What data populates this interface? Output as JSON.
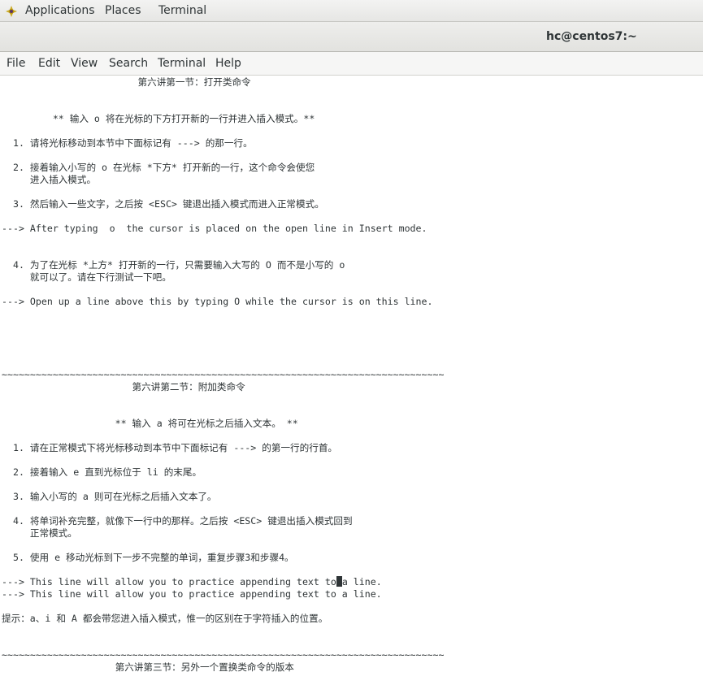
{
  "topbar": {
    "applications": "Applications",
    "places": "Places",
    "terminal": "Terminal"
  },
  "window": {
    "title": "hc@centos7:~"
  },
  "menubar": {
    "file": "File",
    "edit": "Edit",
    "view": "View",
    "search": "Search",
    "terminal": "Terminal",
    "help": "Help"
  },
  "terminal": {
    "lines": {
      "l0": "                        第六讲第一节：打开类命令",
      "l3": "         ** 输入 o 将在光标的下方打开新的一行并进入插入模式。**",
      "l5": "  1. 请将光标移动到本节中下面标记有 ---> 的那一行。",
      "l7": "  2. 接着输入小写的 o 在光标 *下方* 打开新的一行，这个命令会使您",
      "l8": "     进入插入模式。",
      "l10": "  3. 然后输入一些文字，之后按 <ESC> 键退出插入模式而进入正常模式。",
      "l12": "---> After typing  o  the cursor is placed on the open line in Insert mode.",
      "l15": "  4. 为了在光标 *上方* 打开新的一行，只需要输入大写的 O 而不是小写的 o",
      "l16": "     就可以了。请在下行测试一下吧。",
      "l18": "---> Open up a line above this by typing O while the cursor is on this line.",
      "l24": "~~~~~~~~~~~~~~~~~~~~~~~~~~~~~~~~~~~~~~~~~~~~~~~~~~~~~~~~~~~~~~~~~~~~~~~~~~~~~~",
      "l25": "                       第六讲第二节：附加类命令",
      "l28": "                    ** 输入 a 将可在光标之后插入文本。 **",
      "l30": "  1. 请在正常模式下将光标移动到本节中下面标记有 ---> 的第一行的行首。",
      "l32": "  2. 接着输入 e 直到光标位于 li 的末尾。",
      "l34": "  3. 输入小写的 a 则可在光标之后插入文本了。",
      "l36": "  4. 将单词补充完整，就像下一行中的那样。之后按 <ESC> 键退出插入模式回到",
      "l37": "     正常模式。",
      "l39": "  5. 使用 e 移动光标到下一步不完整的单词，重复步骤3和步骤4。",
      "l41a": "---> This line will allow you to practice appending text to",
      "l41b": "a line.",
      "l42": "---> This line will allow you to practice appending text to a line.",
      "l44": "提示：a、i 和 A 都会带您进入插入模式，惟一的区别在于字符插入的位置。",
      "l47": "~~~~~~~~~~~~~~~~~~~~~~~~~~~~~~~~~~~~~~~~~~~~~~~~~~~~~~~~~~~~~~~~~~~~~~~~~~~~~~",
      "l48": "                    第六讲第三节：另外一个置换类命令的版本"
    }
  }
}
